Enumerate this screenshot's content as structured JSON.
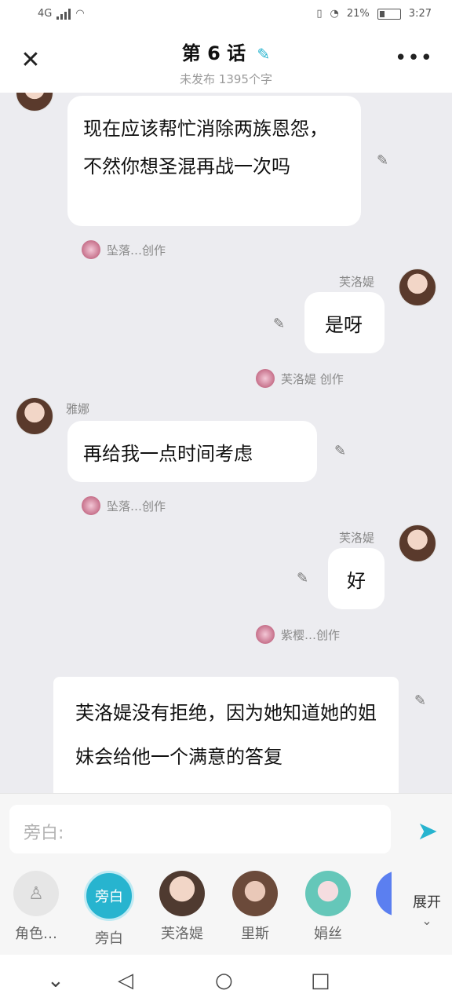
{
  "status": {
    "network": "4G",
    "battery": "21%",
    "time": "3:27"
  },
  "header": {
    "title": "第 6 话",
    "subtitle": "未发布 1395个字"
  },
  "messages": [
    {
      "text": "现在应该帮忙消除两族恩怨，不然你想圣混再战一次吗",
      "credit": "坠落…创作"
    },
    {
      "name": "芙洛媞",
      "text": "是呀",
      "credit": "芙洛媞 创作"
    },
    {
      "name": "雅娜",
      "text": "再给我一点时间考虑",
      "credit": "坠落…创作"
    },
    {
      "name": "芙洛媞",
      "text": "好",
      "credit": "紫樱…创作"
    }
  ],
  "narration": {
    "text": "芙洛媞没有拒绝，因为她知道她的姐妹会给他一个满意的答复"
  },
  "composer": {
    "placeholder": "旁白:",
    "roles": [
      {
        "label": "角色…",
        "icon": "add-role-icon"
      },
      {
        "label": "旁白",
        "icon_text": "旁白"
      },
      {
        "label": "芙洛媞"
      },
      {
        "label": "里斯"
      },
      {
        "label": "娟丝"
      }
    ],
    "expand_label": "展开"
  },
  "colors": {
    "accent": "#27b4cf",
    "background": "#ececf0"
  }
}
